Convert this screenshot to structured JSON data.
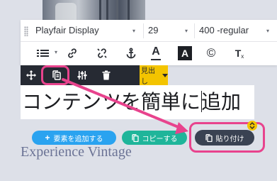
{
  "toolbar": {
    "font_family": "Playfair Display",
    "font_size": "29",
    "font_weight": "400 -regular",
    "icons": [
      "list-icon",
      "link-icon",
      "unlink-icon",
      "anchor-icon",
      "text-color-icon",
      "text-background-icon",
      "copyright-icon",
      "clear-format-icon"
    ],
    "text_color_glyph": "A",
    "bg_color_glyph": "A",
    "copyright_glyph": "©",
    "clear_glyph": "T",
    "clear_sub": "x"
  },
  "block_controls": {
    "icons": [
      "move-icon",
      "copy-icon",
      "settings-icon",
      "delete-icon"
    ],
    "heading_label": "見出し"
  },
  "editor": {
    "text_before_cursor": "コンテンツを簡単に",
    "text_after_cursor": "追加"
  },
  "actions": {
    "add_element": "要素を追加する",
    "add_symbol": "+",
    "copy": "コピーする",
    "paste": "貼り付け"
  },
  "subheading": "Experience Vintage",
  "colors": {
    "background": "#dde0e8",
    "control_bar": "#262a33",
    "accent_yellow": "#f3c400",
    "highlight_pink": "#e8438d",
    "add_blue": "#2aa3f0",
    "copy_teal": "#1fb59a",
    "paste_dark": "#3a4252"
  }
}
